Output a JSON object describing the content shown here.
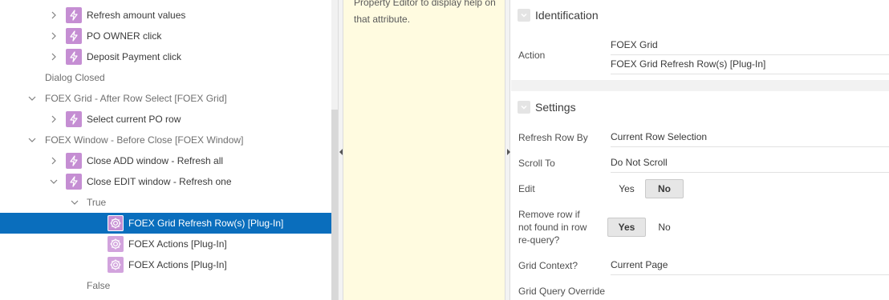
{
  "tree": {
    "items": [
      {
        "label": "Refresh amount values"
      },
      {
        "label": "PO OWNER click"
      },
      {
        "label": "Deposit Payment click"
      },
      {
        "label": "Dialog Closed"
      },
      {
        "label": "FOEX Grid - After Row Select [FOEX Grid]"
      },
      {
        "label": "Select current PO row"
      },
      {
        "label": "FOEX Window - Before Close [FOEX Window]"
      },
      {
        "label": "Close ADD window - Refresh all"
      },
      {
        "label": "Close EDIT window - Refresh one"
      },
      {
        "label": "True"
      },
      {
        "label": "FOEX Grid Refresh Row(s) [Plug-In]"
      },
      {
        "label": "FOEX Actions [Plug-In]"
      },
      {
        "label": "FOEX Actions [Plug-In]"
      },
      {
        "label": "False"
      }
    ],
    "icons": {
      "action": "lightning-icon",
      "plugin": "gear-icon",
      "expand": "chevron-right-icon",
      "collapse": "chevron-down-icon"
    }
  },
  "help": {
    "text": "Property Editor to display help on that attribute."
  },
  "properties": {
    "identification": {
      "title": "Identification",
      "action_label": "Action",
      "action_line1": "FOEX Grid",
      "action_line2": "FOEX Grid Refresh Row(s) [Plug-In]"
    },
    "settings": {
      "title": "Settings",
      "refresh_row_by_label": "Refresh Row By",
      "refresh_row_by_value": "Current Row Selection",
      "scroll_to_label": "Scroll To",
      "scroll_to_value": "Do Not Scroll",
      "edit_label": "Edit",
      "edit_yes": "Yes",
      "edit_no": "No",
      "edit_selected": "No",
      "remove_row_label_1": "Remove row if",
      "remove_row_label_2": "not found in row",
      "remove_row_label_3": "re-query?",
      "remove_yes": "Yes",
      "remove_no": "No",
      "remove_selected": "Yes",
      "grid_context_label": "Grid Context?",
      "grid_context_value": "Current Page",
      "grid_query_override_label": "Grid Query Override"
    }
  },
  "colors": {
    "selection": "#0a6ebd",
    "icon_purple": "#c58ed3",
    "help_bg": "#fffbe0"
  }
}
